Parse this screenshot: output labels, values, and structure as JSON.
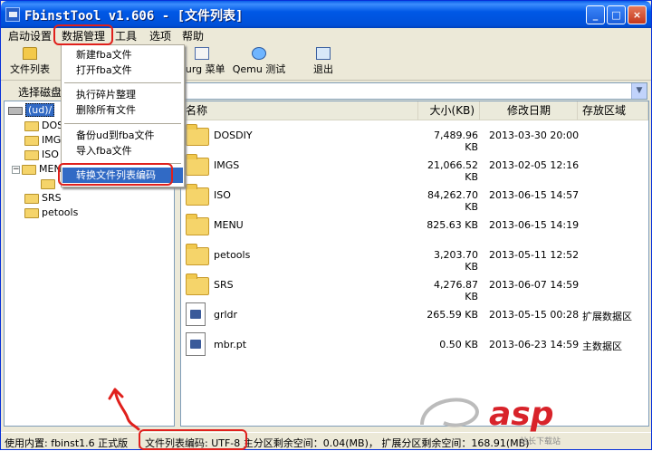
{
  "window": {
    "title": "FbinstTool v1.606 - [文件列表]",
    "min": "_",
    "max": "□",
    "close": "×"
  },
  "menubar": {
    "items": [
      "启动设置",
      "数据管理",
      "工具",
      "选项",
      "帮助"
    ]
  },
  "toolbar": {
    "file_list": "文件列表",
    "burg_menu": "Burg 菜单",
    "qemu_test": "Qemu 测试",
    "exit": "退出"
  },
  "drive": {
    "label": "选择磁盘",
    "combo_arrow": "▼"
  },
  "dropdown": {
    "items": [
      "新建fba文件",
      "打开fba文件",
      "执行碎片整理",
      "删除所有文件",
      "备份ud到fba文件",
      "导入fba文件",
      "转换文件列表编码"
    ]
  },
  "tree": {
    "root": "(ud)/",
    "nodes": [
      "DOSDIY",
      "IMGS",
      "ISO",
      "MENU",
      "",
      "SRS",
      "petools"
    ],
    "expand_minus": "−"
  },
  "list": {
    "headers": [
      "名称",
      "大小(KB)",
      "修改日期",
      "存放区域"
    ],
    "rows": [
      {
        "name": "DOSDIY",
        "size": "7,489.96 KB",
        "date": "2013-03-30 20:00",
        "zone": "",
        "type": "folder"
      },
      {
        "name": "IMGS",
        "size": "21,066.52 KB",
        "date": "2013-02-05 12:16",
        "zone": "",
        "type": "folder"
      },
      {
        "name": "ISO",
        "size": "84,262.70 KB",
        "date": "2013-06-15 14:57",
        "zone": "",
        "type": "folder"
      },
      {
        "name": "MENU",
        "size": "825.63 KB",
        "date": "2013-06-15 14:19",
        "zone": "",
        "type": "folder"
      },
      {
        "name": "petools",
        "size": "3,203.70 KB",
        "date": "2013-05-11 12:52",
        "zone": "",
        "type": "folder"
      },
      {
        "name": "SRS",
        "size": "4,276.87 KB",
        "date": "2013-06-07 14:59",
        "zone": "",
        "type": "folder"
      },
      {
        "name": "grldr",
        "size": "265.59 KB",
        "date": "2013-05-15 00:28",
        "zone": "扩展数据区",
        "type": "file"
      },
      {
        "name": "mbr.pt",
        "size": "0.50 KB",
        "date": "2013-06-23 14:59",
        "zone": "主数据区",
        "type": "file"
      }
    ]
  },
  "status": {
    "core": "使用内置: fbinst1.6 正式版",
    "info": "文件列表编码: UTF-8 主分区剩余空间：0.04(MB)， 扩展分区剩余空间：168.91(MB)"
  },
  "watermark": {
    "brand": "asp",
    "suffix": "站长下载站"
  }
}
